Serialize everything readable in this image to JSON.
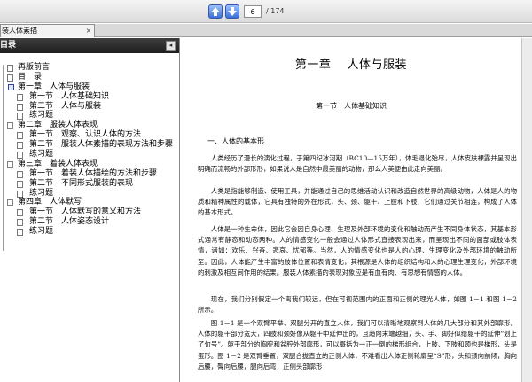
{
  "toolbar": {
    "prev_icon": "arrow-up-icon",
    "next_icon": "arrow-down-icon",
    "page_value": "6",
    "page_total": "/ 174"
  },
  "tab": {
    "label": "装人体素描",
    "close": "×"
  },
  "sidebar": {
    "header": "目录",
    "collapse": "◂",
    "items": [
      {
        "label": "再版前言",
        "level": 0
      },
      {
        "label": "目　录",
        "level": 0
      },
      {
        "label": "第一章　人体与服装",
        "level": 0
      },
      {
        "label": "第一节　人体基础知识",
        "level": 1
      },
      {
        "label": "第二节　人体与服装",
        "level": 1
      },
      {
        "label": "练习题",
        "level": 1
      },
      {
        "label": "第二章　服装人体表现",
        "level": 0
      },
      {
        "label": "第一节　观察、认识人体的方法",
        "level": 1
      },
      {
        "label": "第二节　服装人体素描的表现方法和步骤",
        "level": 1
      },
      {
        "label": "练习题",
        "level": 1
      },
      {
        "label": "第三章　着装人体表现",
        "level": 0
      },
      {
        "label": "第一节　着装人体描绘的方法和步骤",
        "level": 1
      },
      {
        "label": "第二节　不同形式服装的表现",
        "level": 1
      },
      {
        "label": "练习题",
        "level": 1
      },
      {
        "label": "第四章　人体默写",
        "level": 0
      },
      {
        "label": "第一节　人体默写的意义和方法",
        "level": 1
      },
      {
        "label": "第二节　人体姿态设计",
        "level": 1
      },
      {
        "label": "练习题",
        "level": 1
      }
    ]
  },
  "page": {
    "chapter_title": "第一章　 人体与服装",
    "section_title": "第一节　人体基础知识",
    "heading": "一、人体的基本形",
    "paragraphs": [
      "人类经历了漫长的演化过程，于第四纪冰河期（BC10—15万年），体毛退化殆尽，人体皮肤裸露并呈现出明确而流畅的外部形形，如果说人是自然中最美丽的动物，那么人美便由此走向美丽。",
      "人类是指能够制造、使用工具，并能通过自己的思维活动认识和改造自然世界的高级动物，人体是人的物质和精神属性的载体，它具有独特的外在形式，头、颈、躯干、上肢和下肢，它们通过关节相连，构成了人体的基本形式。",
      "人体是一种生命体，因此它会因自身心理、生理及外部环境的变化和触动而产生不同身体状态，其基本形式通常有静态和动态两种。人的情感变化一般会通过人体形式直接表现出来，而呈现出不同的面部或肢体表情，诸如：欢乐、兴奋、悲哀、忧郁等。当然，人的情感变化也是人的心理、生理变化及外部环境的触动所至。因此，人体能产生丰富的肢体位置和表情变化，其根源是人体的组织结构和人的心理生理变化，外部环境的刺激及相互间作用的结果。服装人体素描的表现对象应是有血有肉、有思想有情感的人体。",
      "现在，我们分别假定一个离我们较远，但在可视范围内的正面和正侧的理光人体，如图 1－1 和图 1－2 所示。",
      "图 1－1 是一个双臂平举、双腿分开的直立人体，我们可以清晰地观察到人体的几大部分和其外部廓形。人体的躯干部分宽大，四肢和颈好像从躯干中延伸出的，且趋向末端越细，头、手、脚好似给躯干的延伸“划上了句号”。躯干部分的胸腔和盆腔外部廓形，可以概括为一正一倒的梯形组合，上肢、下肢和颈也是梯形，头是蛋形。图 1－2 是双臂垂置，双腿合拢直立的正侧人体，不难看出人体正侧轮廓呈“S”形，头和颈向前倾，胸向后腰，臀向后腰，腿向后弯，正侧头部廓形"
    ]
  },
  "colors": {
    "sidebar_header_bg": "#2a2a2a",
    "nav_button": "#3d6fd9",
    "chapter_icon": "#2f3f9e"
  }
}
